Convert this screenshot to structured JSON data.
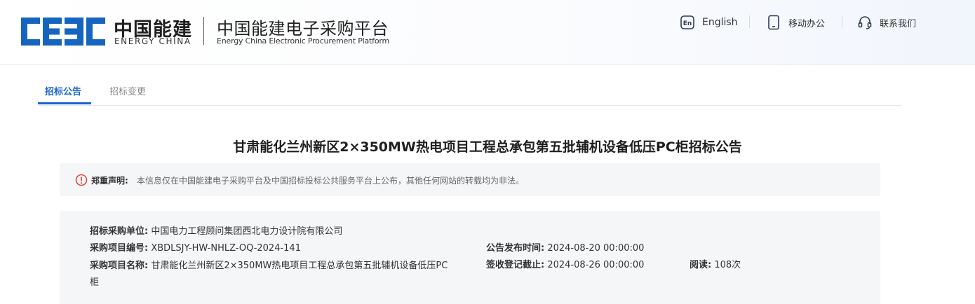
{
  "brand": {
    "logo_letters": "CEEC",
    "name_cn": "中国能建",
    "name_en": "ENERGY CHINA",
    "platform_cn": "中国能建电子采购平台",
    "platform_en": "Energy China Electronic Procurement Platform",
    "color": "#1565c0"
  },
  "toolbar": [
    {
      "label": "English",
      "icon": "en-badge-icon"
    },
    {
      "label": "移动办公",
      "icon": "mobile-phone-icon"
    },
    {
      "label": "联系我们",
      "icon": "headset-icon"
    }
  ],
  "tabs": [
    {
      "label": "招标公告",
      "active": true
    },
    {
      "label": "招标变更",
      "active": false
    }
  ],
  "article": {
    "title": "甘肃能化兰州新区2×350MW热电项目工程总承包第五批辅机设备低压PC柜招标公告"
  },
  "notice": {
    "icon": "alert-circle-icon",
    "label": "郑重声明:",
    "text": "本信息仅在中国能建电子采购平台及中国招标投标公共服务平台上公布，其他任何网站的转载均为非法。"
  },
  "info": {
    "unit_label": "招标采购单位:",
    "unit_value": "中国电力工程顾问集团西北电力设计院有限公司",
    "code_label": "采购项目编号:",
    "code_value": "XBDLSJY-HW-NHLZ-OQ-2024-141",
    "publish_label": "公告发布时间:",
    "publish_value": "2024-08-20 00:00:00",
    "name_label": "采购项目名称:",
    "name_value": "甘肃能化兰州新区2×350MW热电项目工程总承包第五批辅机设备低压PC柜",
    "deadline_label": "签收登记截止:",
    "deadline_value": "2024-08-26 00:00:00",
    "reads_label": "阅读:",
    "reads_value": "108次"
  },
  "colors": {
    "accent": "#1a66c9",
    "alert": "#e04a3a",
    "panel_bg": "#f5f6f8"
  }
}
